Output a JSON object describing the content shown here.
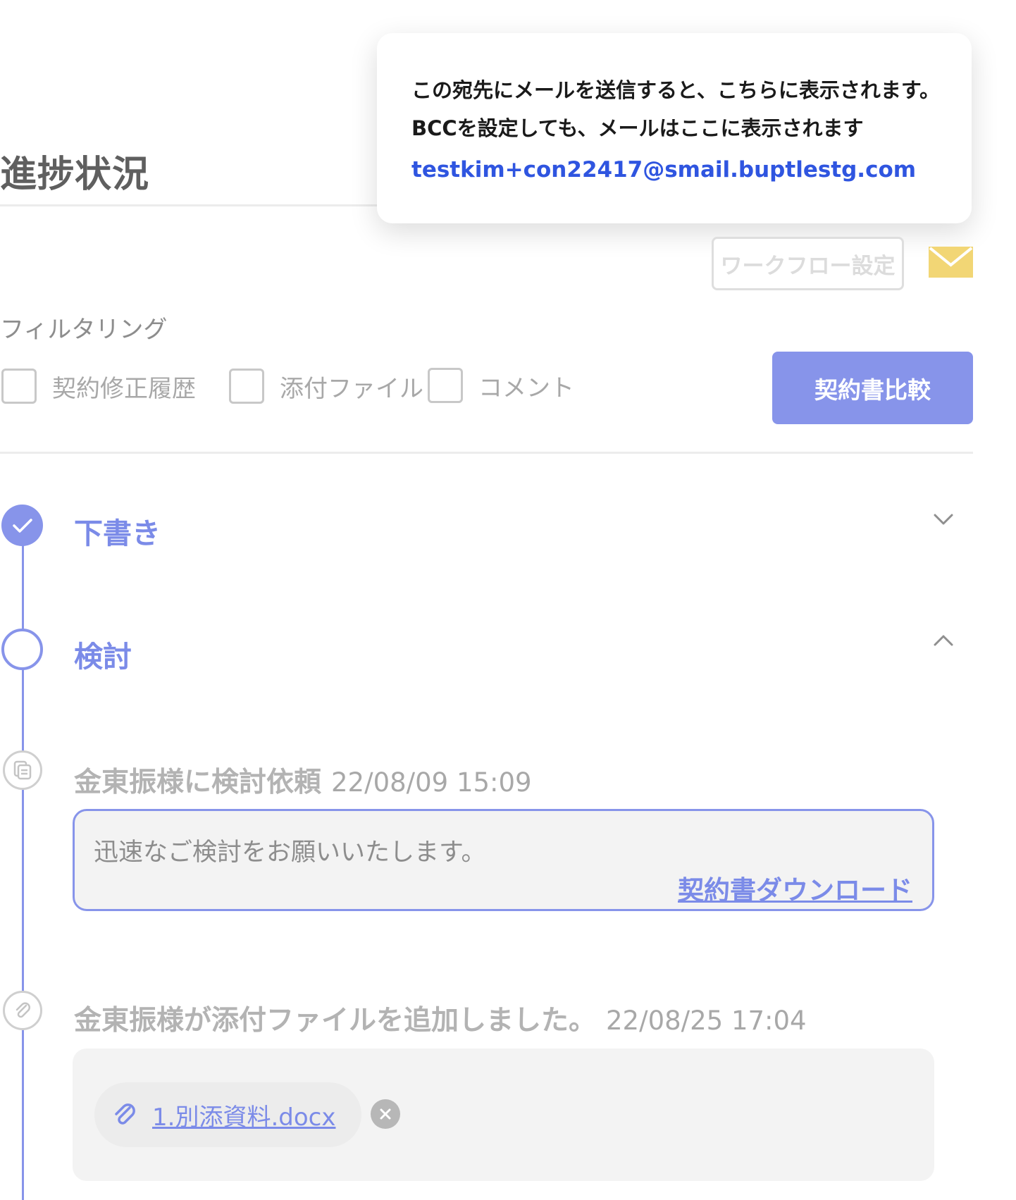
{
  "page_title": "進捗状況",
  "tooltip": {
    "line1": "この宛先にメールを送信すると、こちらに表示されます。",
    "line2": "BCCを設定しても、メールはここに表示されます",
    "email": "testkim+con22417@smail.buptlestg.com"
  },
  "toolbar": {
    "workflow_button": "ワークフロー設定",
    "mail_icon": "envelope-icon"
  },
  "filter": {
    "label": "フィルタリング",
    "options": [
      {
        "label": "契約修正履歴",
        "checked": false
      },
      {
        "label": "添付ファイル",
        "checked": false
      },
      {
        "label": "コメント",
        "checked": false
      }
    ],
    "compare_button": "契約書比較"
  },
  "steps": [
    {
      "title": "下書き",
      "state": "done",
      "expanded": false
    },
    {
      "title": "検討",
      "state": "current",
      "expanded": true
    }
  ],
  "events": [
    {
      "icon": "document-icon",
      "title": "金東振様に検討依頼",
      "time": "22/08/09 15:09",
      "comment": "迅速なご検討をお願いいたします。",
      "link": "契約書ダウンロード"
    },
    {
      "icon": "paperclip-icon",
      "title": "金東振様が添付ファイルを追加しました。",
      "time": "22/08/25 17:04",
      "file": "1.別添資料.docx"
    }
  ],
  "colors": {
    "accent": "#8794ea",
    "link": "#2f55e0",
    "mail": "#f2d675"
  }
}
